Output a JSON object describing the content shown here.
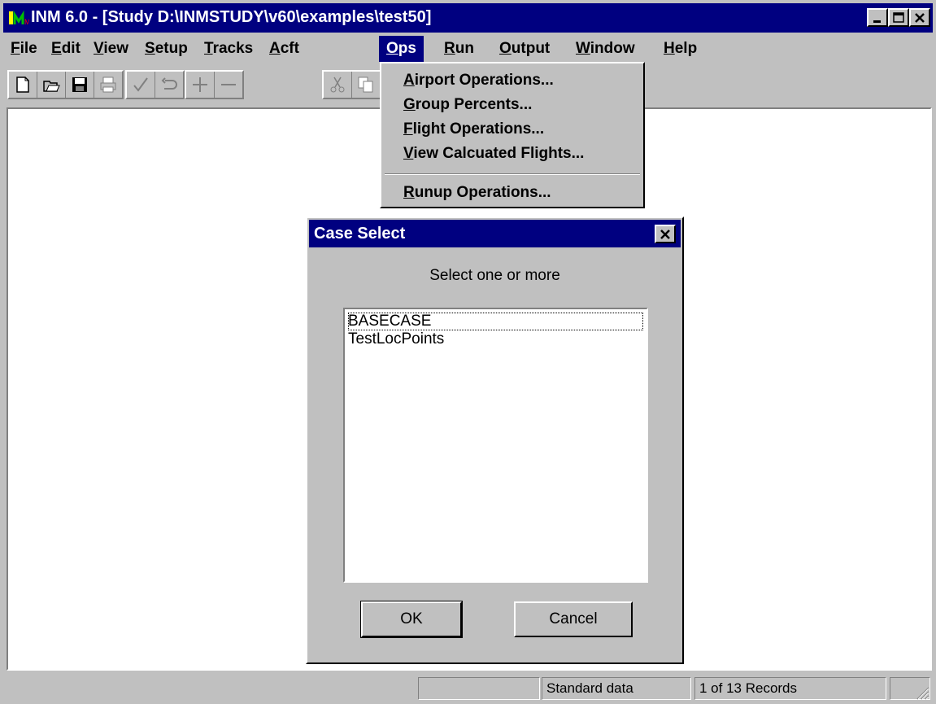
{
  "window": {
    "title": "INM 6.0 - [Study D:\\INMSTUDY\\v60\\examples\\test50]"
  },
  "menubar": {
    "items": [
      {
        "label": "File"
      },
      {
        "label": "Edit"
      },
      {
        "label": "View"
      },
      {
        "label": "Setup"
      },
      {
        "label": "Tracks"
      },
      {
        "label": "Acft"
      },
      {
        "label": "Ops"
      },
      {
        "label": "Run"
      },
      {
        "label": "Output"
      },
      {
        "label": "Window"
      },
      {
        "label": "Help"
      }
    ],
    "open_menu": "Ops"
  },
  "ops_menu": {
    "items": [
      {
        "label": "Airport Operations..."
      },
      {
        "label": "Group Percents..."
      },
      {
        "label": "Flight Operations..."
      },
      {
        "label": "View Calcuated Flights..."
      },
      {
        "label": "Runup Operations..."
      }
    ]
  },
  "toolbar": {
    "icons": [
      "new-icon",
      "open-icon",
      "save-icon",
      "print-icon",
      "check-icon",
      "undo-icon",
      "add-icon",
      "remove-icon",
      "cut-icon",
      "copy-icon"
    ]
  },
  "dialog": {
    "title": "Case Select",
    "prompt": "Select one or more",
    "cases": [
      {
        "label": "BASECASE"
      },
      {
        "label": "TestLocPoints"
      }
    ],
    "ok_label": "OK",
    "cancel_label": "Cancel"
  },
  "statusbar": {
    "data_type": "Standard data",
    "records": "1 of 13 Records"
  },
  "colors": {
    "titlebar": "#000080",
    "face": "#c0c0c0",
    "client": "#ffffff"
  }
}
